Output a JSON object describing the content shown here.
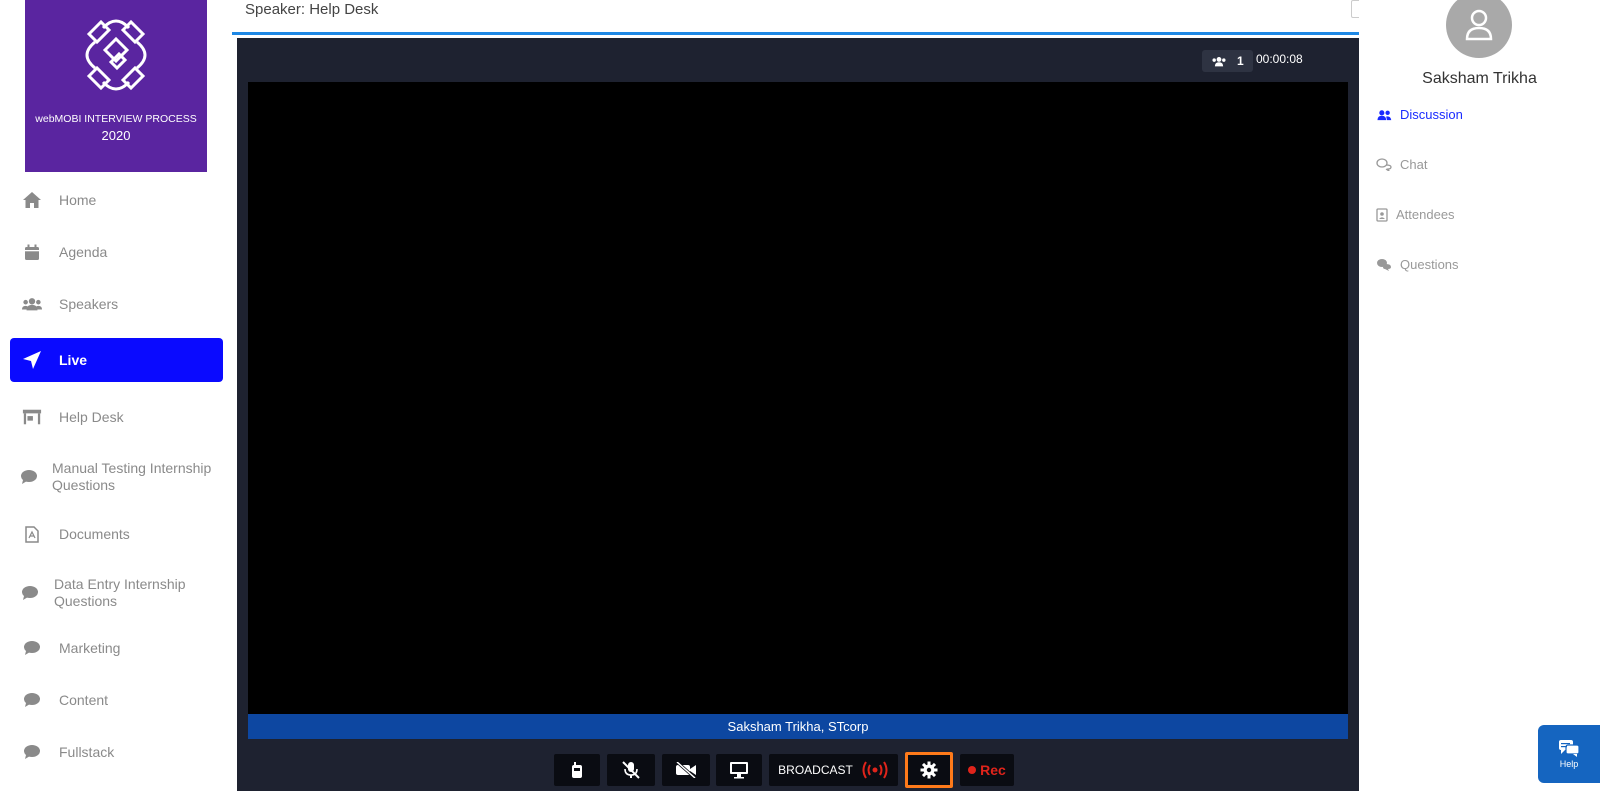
{
  "colors": {
    "logo_bg": "#5a25a0",
    "active_nav": "#0a0aff",
    "stage_bg": "#1e2230",
    "name_bar": "#0d47a1",
    "accent_line": "#1e88e5",
    "settings_highlight": "#ff7a1a",
    "rec_red": "#e0241b",
    "discussion_blue": "#1a2bff",
    "help_bg": "#1565c0"
  },
  "logo": {
    "icon": "rings-logo",
    "line1": "webMOBI INTERVIEW PROCESS",
    "line2": "2020"
  },
  "sidebar": {
    "items": [
      {
        "label": "Home",
        "icon": "home-icon",
        "active": false
      },
      {
        "label": "Agenda",
        "icon": "calendar-icon",
        "active": false
      },
      {
        "label": "Speakers",
        "icon": "users-icon",
        "active": false
      },
      {
        "label": "Live",
        "icon": "paper-plane-icon",
        "active": true
      },
      {
        "label": "Help Desk",
        "icon": "store-icon",
        "active": false
      },
      {
        "label": "Manual Testing Internship Questions",
        "icon": "comment-icon",
        "active": false
      },
      {
        "label": "Documents",
        "icon": "pdf-file-icon",
        "active": false
      },
      {
        "label": "Data Entry Internship Questions",
        "icon": "comment-icon",
        "active": false
      },
      {
        "label": "Marketing",
        "icon": "comment-icon",
        "active": false
      },
      {
        "label": "Content",
        "icon": "comment-icon",
        "active": false
      },
      {
        "label": "Fullstack",
        "icon": "comment-icon",
        "active": false
      }
    ]
  },
  "header": {
    "title": "Speaker: Help Desk"
  },
  "stage": {
    "viewer_count": "1",
    "timer": "00:00:08",
    "speaker_name": "Saksham Trikha, STcorp"
  },
  "controls": {
    "broadcast_label": "BROADCAST",
    "rec_label": "Rec"
  },
  "right_panel": {
    "user_name": "Saksham Trikha",
    "tabs": [
      {
        "label": "Discussion",
        "icon": "users-icon",
        "active": true
      },
      {
        "label": "Chat",
        "icon": "chat-icon",
        "active": false
      },
      {
        "label": "Attendees",
        "icon": "contact-book-icon",
        "active": false
      },
      {
        "label": "Questions",
        "icon": "comments-icon",
        "active": false
      }
    ]
  },
  "help_widget": {
    "label": "Help"
  }
}
